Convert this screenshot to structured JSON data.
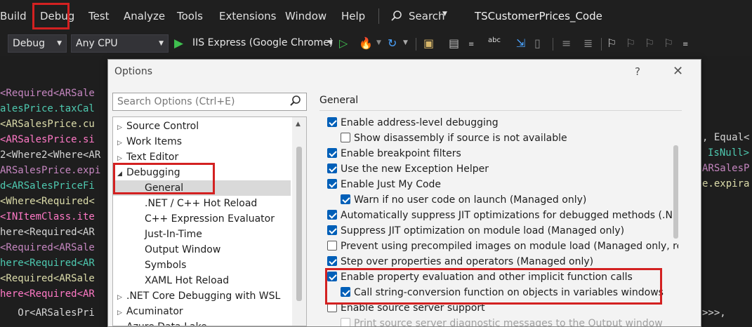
{
  "menubar": {
    "items": [
      "Build",
      "Debug",
      "Test",
      "Analyze",
      "Tools",
      "Extensions",
      "Window",
      "Help"
    ],
    "search_label": "Search",
    "solution_title": "TSCustomerPrices_Code"
  },
  "toolbar": {
    "config": "Debug",
    "platform": "Any CPU",
    "run_target": "IIS Express (Google Chrome)"
  },
  "editor": {
    "left_fragments": [
      "<Required<ARSale",
      "alesPrice.taxCal",
      "<ARSalesPrice.cu",
      "<ARSalesPrice.si",
      "2<Where2<Where<AR",
      "ARSalesPrice.expi",
      "d<ARSalesPriceFi",
      "<Where<Required<",
      "<INItemClass.ite",
      "here<Required<AR",
      "<Required<ARSale",
      "here<Required<AR",
      "<Required<ARSale",
      "here<Required<AR",
      "   Or<ARSalesPri"
    ],
    "right_fragments": [
      ", Equal<",
      "IsNull>",
      "ARSalesP",
      "e.expira",
      ">>>,"
    ]
  },
  "dialog": {
    "title": "Options",
    "help": "?",
    "search_placeholder": "Search Options (Ctrl+E)",
    "tree": [
      {
        "label": "Source Control",
        "level": 0,
        "state": "collapsed"
      },
      {
        "label": "Work Items",
        "level": 0,
        "state": "collapsed"
      },
      {
        "label": "Text Editor",
        "level": 0,
        "state": "collapsed"
      },
      {
        "label": "Debugging",
        "level": 0,
        "state": "expanded"
      },
      {
        "label": "General",
        "level": 1,
        "state": "selected"
      },
      {
        "label": ".NET / C++ Hot Reload",
        "level": 1,
        "state": "leaf"
      },
      {
        "label": "C++ Expression Evaluator",
        "level": 1,
        "state": "leaf"
      },
      {
        "label": "Just-In-Time",
        "level": 1,
        "state": "leaf"
      },
      {
        "label": "Output Window",
        "level": 1,
        "state": "leaf"
      },
      {
        "label": "Symbols",
        "level": 1,
        "state": "leaf"
      },
      {
        "label": "XAML Hot Reload",
        "level": 1,
        "state": "leaf"
      },
      {
        "label": ".NET Core Debugging with WSL",
        "level": 0,
        "state": "collapsed"
      },
      {
        "label": "Acuminator",
        "level": 0,
        "state": "collapsed"
      },
      {
        "label": "Azure Data Lake",
        "level": 0,
        "state": "collapsed"
      }
    ],
    "section_title": "General",
    "options": [
      {
        "label": "Enable address-level debugging",
        "checked": true,
        "indent": 0
      },
      {
        "label": "Show disassembly if source is not available",
        "checked": false,
        "indent": 1
      },
      {
        "label": "Enable breakpoint filters",
        "checked": true,
        "indent": 0
      },
      {
        "label": "Use the new Exception Helper",
        "checked": true,
        "indent": 0
      },
      {
        "label": "Enable Just My Code",
        "checked": true,
        "indent": 0
      },
      {
        "label": "Warn if no user code on launch (Managed only)",
        "checked": true,
        "indent": 1
      },
      {
        "label": "Automatically suppress JIT optimizations for debugged methods (.NE",
        "checked": true,
        "indent": 0
      },
      {
        "label": "Suppress JIT optimization on module load (Managed only)",
        "checked": true,
        "indent": 0
      },
      {
        "label": "Prevent using precompiled images on module load (Managed only, re",
        "checked": false,
        "indent": 0
      },
      {
        "label": "Step over properties and operators (Managed only)",
        "checked": true,
        "indent": 0
      },
      {
        "label": "Enable property evaluation and other implicit function calls",
        "checked": true,
        "indent": 0
      },
      {
        "label": "Call string-conversion function on objects in variables windows",
        "checked": true,
        "indent": 1
      },
      {
        "label": "Enable source server support",
        "checked": false,
        "indent": 0
      },
      {
        "label": "Print source server diagnostic messages to the Output window",
        "checked": false,
        "indent": 1,
        "disabled": true
      }
    ]
  },
  "colors": {
    "highlight": "#d32121",
    "checkbox_accent": "#005fb8",
    "editor_bg": "#1e1e1e",
    "dialog_bg": "#f3f3f3"
  }
}
